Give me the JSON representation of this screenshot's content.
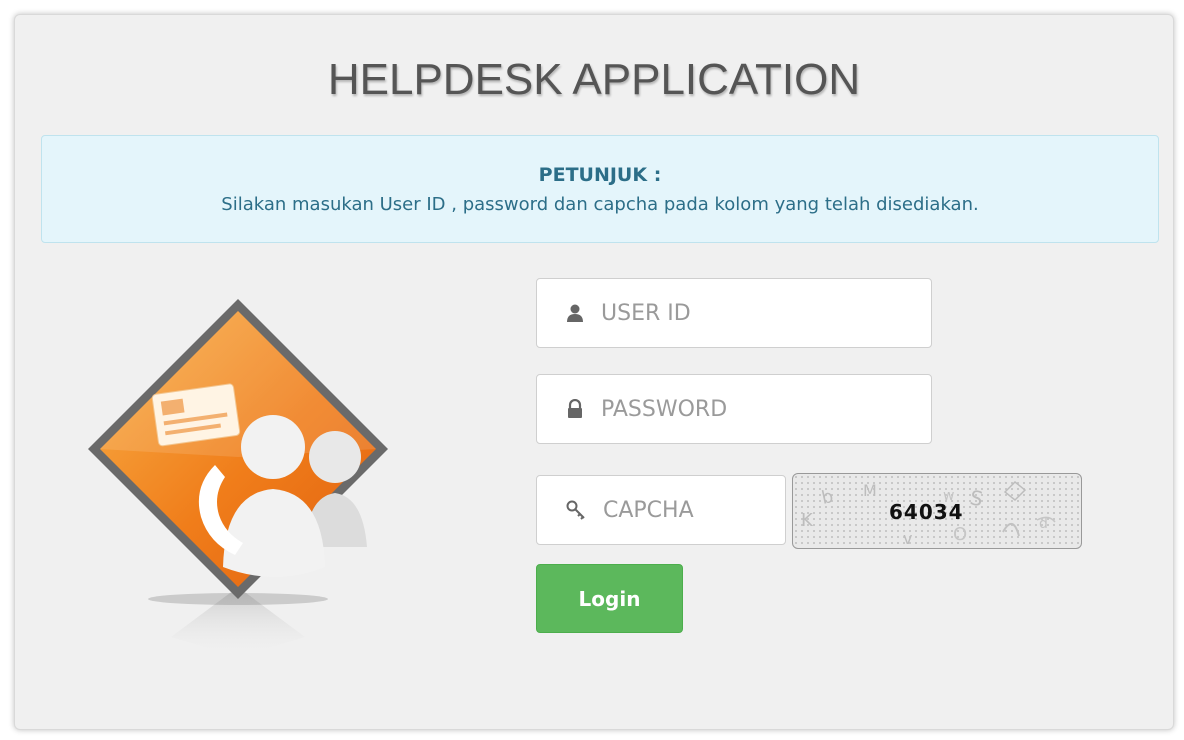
{
  "app": {
    "title": "HELPDESK APPLICATION"
  },
  "info": {
    "title": "PETUNJUK :",
    "text": "Silakan masukan User ID , password dan capcha pada kolom yang telah disediakan."
  },
  "form": {
    "userid_placeholder": "USER ID",
    "password_placeholder": "PASSWORD",
    "capcha_placeholder": "CAPCHA",
    "captcha_code": "64034",
    "login_label": "Login"
  },
  "icons": {
    "user": "user-icon",
    "lock": "lock-icon",
    "key": "key-icon",
    "logo": "helpdesk-logo"
  },
  "colors": {
    "login": "#5cb85c",
    "info_bg": "#e4f5fb",
    "info_text": "#2c6e88",
    "logo_orange": "#f07d1a"
  }
}
